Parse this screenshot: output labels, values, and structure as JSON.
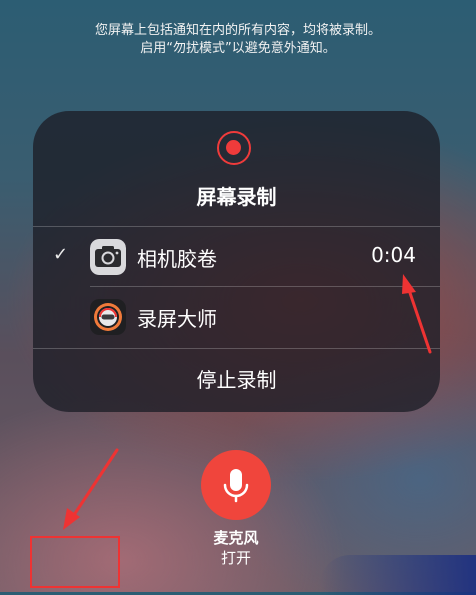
{
  "notice": {
    "line1": "您屏幕上包括通知在内的所有内容，均将被录制。",
    "line2": "启用“勿扰模式”以避免意外通知。"
  },
  "panel": {
    "title": "屏幕录制",
    "options": [
      {
        "label": "相机胶卷",
        "time": "0:04",
        "selected": true,
        "check": "✓",
        "icon": "camera-icon"
      },
      {
        "label": "录屏大师",
        "selected": false,
        "icon": "recorder-app-icon"
      }
    ],
    "stop_label": "停止录制"
  },
  "microphone": {
    "label": "麦克风",
    "state": "打开",
    "icon": "microphone-icon"
  },
  "colors": {
    "record_red": "#ef3b3b",
    "mic_red": "#f0453c",
    "annotation_red": "#e33333"
  }
}
